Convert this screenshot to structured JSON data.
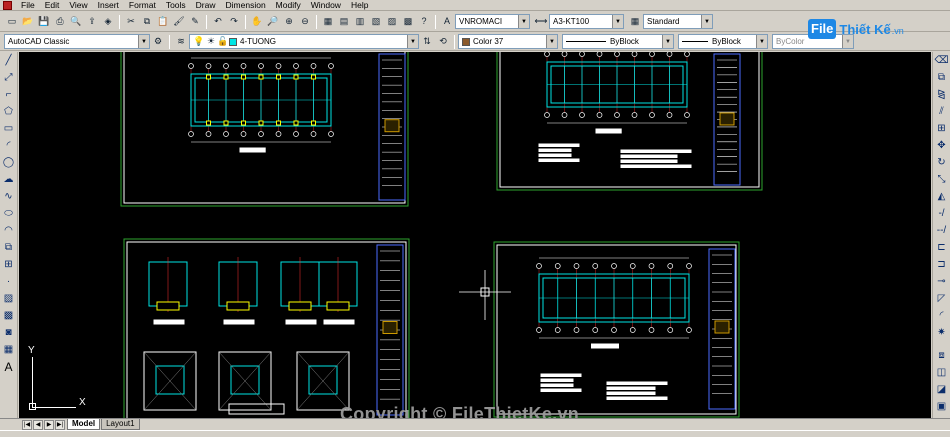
{
  "menu": [
    "File",
    "Edit",
    "View",
    "Insert",
    "Format",
    "Tools",
    "Draw",
    "Dimension",
    "Modify",
    "Window",
    "Help"
  ],
  "toolbar": {
    "text_style": "VNROMACI",
    "dim_style": "A3-KT100",
    "table_style": "Standard",
    "workspace": "AutoCAD Classic",
    "layer": "4-TUONG",
    "color": "Color 37",
    "linetype": "ByBlock",
    "lineweight": "ByBlock",
    "plot_style": "ByColor"
  },
  "tabs": [
    "Model",
    "Layout1"
  ],
  "active_tab": "Model",
  "ucs": {
    "x_label": "X",
    "y_label": "Y"
  },
  "brand": {
    "file": "File",
    "name": "Thiết Kế",
    "tld": ".vn"
  },
  "watermark": "Copyright © FileThietKe.vn",
  "palette": {
    "canvas": "#000000",
    "frame": "#2ea32e",
    "sheet": "#4d6bff",
    "plan": "#00e5e5",
    "column": "#ffff00",
    "grid": "#ff3030"
  }
}
